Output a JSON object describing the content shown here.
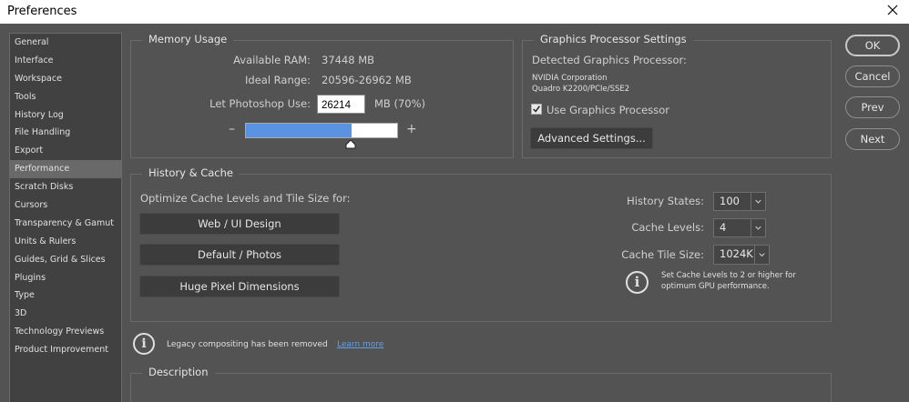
{
  "window": {
    "title": "Preferences",
    "close_icon": "close-icon"
  },
  "sidebar": {
    "items": [
      {
        "label": "General"
      },
      {
        "label": "Interface"
      },
      {
        "label": "Workspace"
      },
      {
        "label": "Tools"
      },
      {
        "label": "History Log"
      },
      {
        "label": "File Handling"
      },
      {
        "label": "Export"
      },
      {
        "label": "Performance",
        "active": true
      },
      {
        "label": "Scratch Disks"
      },
      {
        "label": "Cursors"
      },
      {
        "label": "Transparency & Gamut"
      },
      {
        "label": "Units & Rulers"
      },
      {
        "label": "Guides, Grid & Slices"
      },
      {
        "label": "Plugins"
      },
      {
        "label": "Type"
      },
      {
        "label": "3D"
      },
      {
        "label": "Technology Previews"
      },
      {
        "label": "Product Improvement"
      }
    ]
  },
  "memory": {
    "title": "Memory Usage",
    "available_label": "Available RAM:",
    "available_value": "37448 MB",
    "ideal_label": "Ideal Range:",
    "ideal_value": "20596-26962 MB",
    "let_label": "Let Photoshop Use:",
    "let_value": "26214",
    "let_unit": "MB (70%)",
    "minus": "–",
    "plus": "+",
    "slider_fraction": 0.7
  },
  "gpu": {
    "title": "Graphics Processor Settings",
    "detected_label": "Detected Graphics Processor:",
    "vendor": "NVIDIA Corporation",
    "model": "Quadro K2200/PCIe/SSE2",
    "use_label": "Use Graphics Processor",
    "use_checked": true,
    "advanced_button": "Advanced Settings..."
  },
  "history_cache": {
    "title": "History & Cache",
    "optimize_label": "Optimize Cache Levels and Tile Size for:",
    "buttons": [
      "Web / UI Design",
      "Default / Photos",
      "Huge Pixel Dimensions"
    ],
    "history_states_label": "History States:",
    "history_states_value": "100",
    "cache_levels_label": "Cache Levels:",
    "cache_levels_value": "4",
    "tile_size_label": "Cache Tile Size:",
    "tile_size_value": "1024K",
    "note_line1": "Set Cache Levels to 2 or higher for",
    "note_line2": "optimum GPU performance."
  },
  "legacy": {
    "message": "Legacy compositing has been removed",
    "link": "Learn more"
  },
  "description": {
    "title": "Description"
  },
  "actions": {
    "ok": "OK",
    "cancel": "Cancel",
    "prev": "Prev",
    "next": "Next"
  },
  "colors": {
    "background": "#535353",
    "sidebar": "#414141",
    "slider_fill": "#5b93e3",
    "link": "#5ea0f0"
  }
}
